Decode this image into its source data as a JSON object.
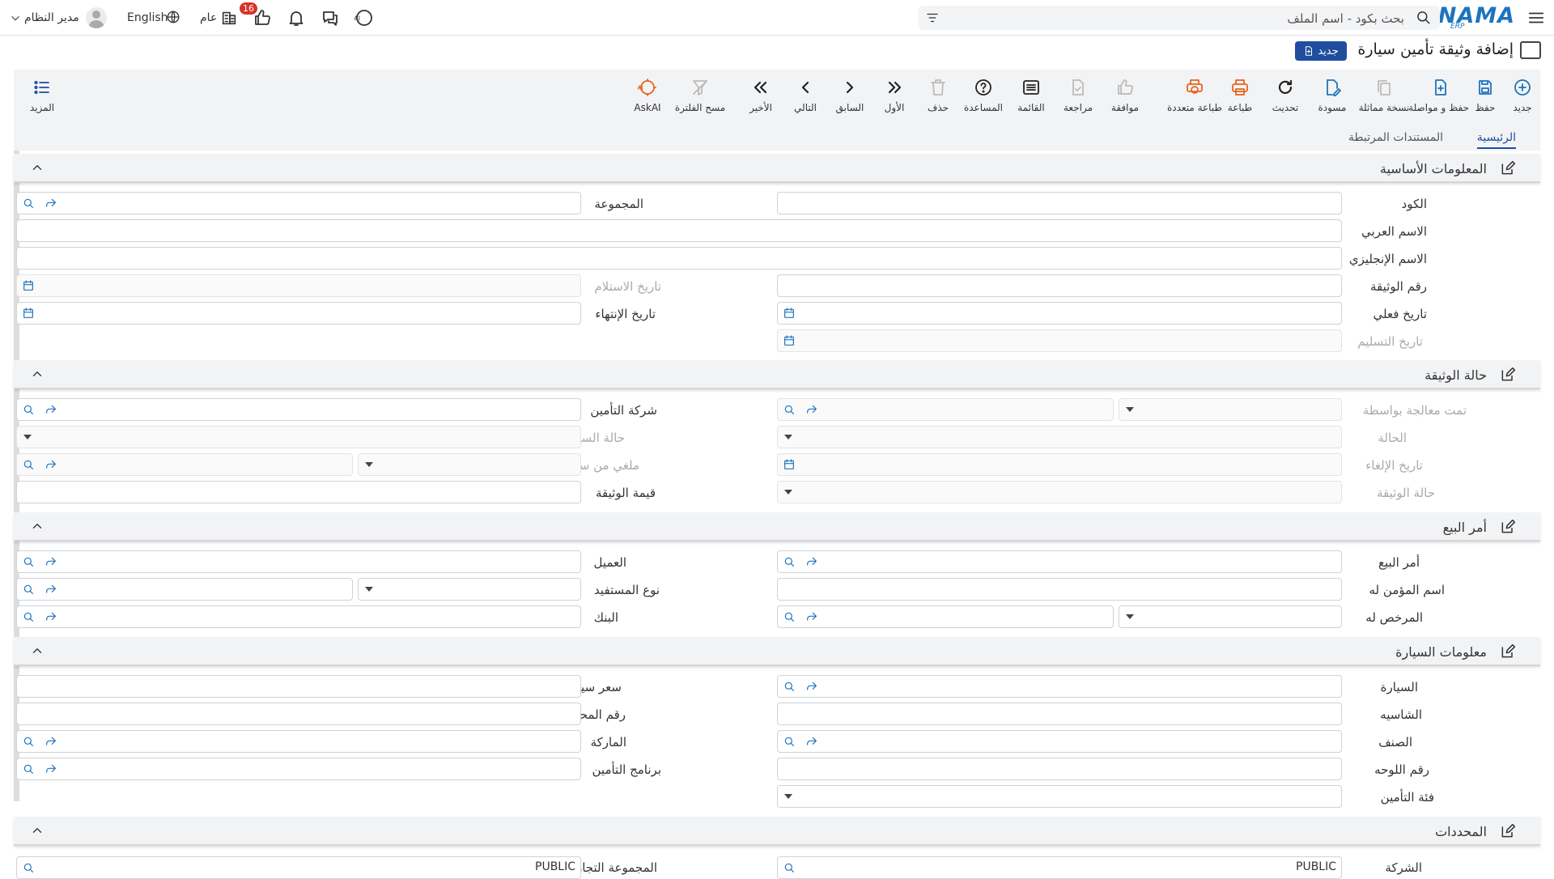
{
  "topbar": {
    "brand": "NAMA",
    "brand_sub": "ERP",
    "search_placeholder": "بحث بكود - اسم الملف",
    "user_name": "مدير النظام",
    "language": "English",
    "branch_label": "عام",
    "notif_count": "16"
  },
  "page": {
    "title": "إضافة وثيقة تأمين سيارة",
    "status_badge": "جديد"
  },
  "toolbar": {
    "new": "جديد",
    "save": "حفظ",
    "save_continue": "حفظ و مواصلة",
    "duplicate": "نسخة مماثلة",
    "draft": "مسودة",
    "refresh": "تحديث",
    "print": "طباعة",
    "multi_print": "طباعة متعددة",
    "approve": "موافقة",
    "review": "مراجعة",
    "list": "القائمة",
    "help": "المساعدة",
    "delete": "حذف",
    "first": "الأول",
    "previous": "السابق",
    "next": "التالي",
    "last": "الأخير",
    "clear_filter": "مسح الفلترة",
    "askai": "AskAI",
    "more": "المزيد"
  },
  "tabs": {
    "main": "الرئيسية",
    "related": "المستندات المرتبطة"
  },
  "sections": {
    "basic": "المعلومات الأساسية",
    "doc_status": "حالة الوثيقة",
    "sales_order": "أمر البيع",
    "car_info": "معلومات السيارة",
    "determinants": "المحددات"
  },
  "fields": {
    "code": "الكود",
    "group": "المجموعة",
    "arabic_name": "الاسم العربي",
    "english_name": "الاسم الإنجليزي",
    "doc_number": "رقم الوثيقة",
    "receipt_date": "تاريخ الاستلام",
    "actual_date": "تاريخ فعلي",
    "end_date": "تاريخ الإنتهاء",
    "delivery_date": "تاريخ التسليم",
    "processed_by": "تمت معالجة بواسطة",
    "insurance_company": "شركة التأمين",
    "status": "الحالة",
    "payment_status": "حالة السداد",
    "cancel_date": "تاريخ الإلغاء",
    "cancelled_from_doc": "ملغي من سند",
    "doc_state": "حالة الوثيقة",
    "doc_value": "قيمة الوثيقة",
    "sales_order": "أمر البيع",
    "customer": "العميل",
    "insured_name": "اسم المؤمن له",
    "beneficiary_type": "نوع المستفيد",
    "licensee": "المرخص له",
    "bank": "البنك",
    "car": "السيارة",
    "car_price": "سعر سيارة",
    "chassis": "الشاسيه",
    "engine_number": "رقم المحرك",
    "class": "الصنف",
    "brand": "الماركة",
    "plate_number": "رقم اللوحه",
    "insurance_program": "برنامج التأمين",
    "insurance_category": "فئة التأمين",
    "company": "الشركة",
    "business_group": "المجموعة التجارية",
    "company_value": "PUBLIC",
    "business_group_value": "PUBLIC"
  }
}
